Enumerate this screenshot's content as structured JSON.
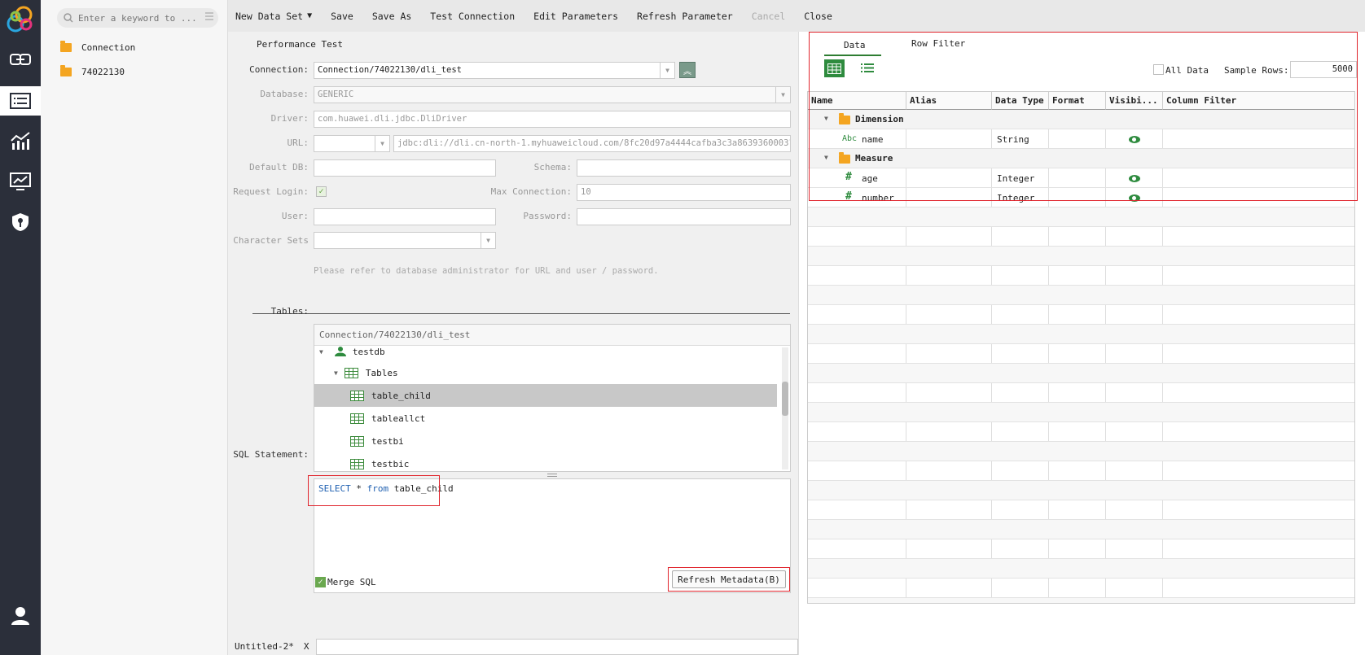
{
  "rail": {
    "icons": [
      "app-logo-icon",
      "link-icon",
      "dataset-list-icon",
      "chart-icon",
      "dashboard-icon",
      "shield-icon",
      "user-icon"
    ]
  },
  "tree": {
    "search_placeholder": "Enter a keyword to ...",
    "items": [
      {
        "label": "Connection"
      },
      {
        "label": "74022130"
      }
    ]
  },
  "toolbar": {
    "new_data_set": "New Data Set",
    "save": "Save",
    "save_as": "Save As",
    "test_connection": "Test Connection",
    "edit_parameters": "Edit Parameters",
    "refresh_parameter": "Refresh Parameter",
    "cancel": "Cancel",
    "close": "Close"
  },
  "form": {
    "tab_title": "Performance Test",
    "connection_label": "Connection:",
    "connection_value": "Connection/74022130/dli_test",
    "database_label": "Database:",
    "database_value": "GENERIC",
    "driver_label": "Driver:",
    "driver_value": "com.huawei.dli.jdbc.DliDriver",
    "url_label": "URL:",
    "url_value": "jdbc:dli://dli.cn-north-1.myhuaweicloud.com/8fc20d97a4444cafba3c3a8639360003?queue",
    "default_db_label": "Default DB:",
    "schema_label": "Schema:",
    "request_login_label": "Request Login:",
    "max_connection_label": "Max Connection:",
    "max_connection_value": "10",
    "user_label": "User:",
    "password_label": "Password:",
    "charset_label": "B Character Sets:",
    "hint": "Please refer to database administrator for URL and user / password.",
    "tables_label": "Tables:",
    "tables_header": "Connection/74022130/dli_test",
    "tables_tree": {
      "db": "testdb",
      "group": "Tables",
      "items": [
        "table_child",
        "tableallct",
        "testbi",
        "testbic"
      ],
      "selected": "table_child"
    },
    "sql_label": "SQL Statement:",
    "sql": {
      "kw1": "SELECT",
      "star": " * ",
      "kw2": "from",
      "table": " table_child"
    },
    "merge_sql": "Merge SQL",
    "refresh_metadata": "Refresh Metadata(B)"
  },
  "bottom_tab": {
    "label": "Untitled-2*",
    "close": "X"
  },
  "right": {
    "tabs": [
      "Data",
      "Row Filter"
    ],
    "all_data_label": "All Data",
    "sample_rows_label": "Sample Rows:",
    "sample_rows_value": "5000",
    "columns": [
      "Name",
      "Alias",
      "Data Type",
      "Format",
      "Visibi...",
      "Column Filter"
    ],
    "rows": [
      {
        "type": "group",
        "name": "Dimension"
      },
      {
        "type": "field",
        "kind": "Abc",
        "name": "name",
        "data_type": "String",
        "visible": true
      },
      {
        "type": "group",
        "name": "Measure"
      },
      {
        "type": "field",
        "kind": "#",
        "name": "age",
        "data_type": "Integer",
        "visible": true
      },
      {
        "type": "field",
        "kind": "#",
        "name": "number",
        "data_type": "Integer",
        "visible": true
      }
    ]
  }
}
